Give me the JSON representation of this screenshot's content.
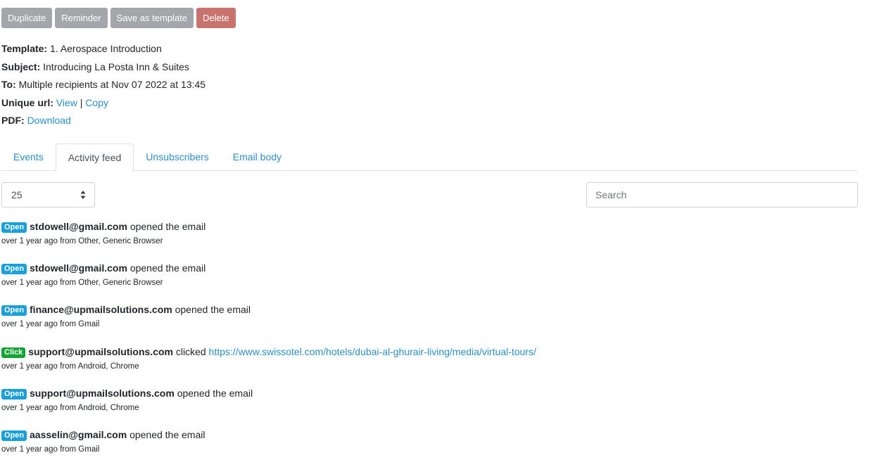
{
  "toolbar": {
    "duplicate_label": "Duplicate",
    "reminder_label": "Reminder",
    "save_template_label": "Save as template",
    "delete_label": "Delete"
  },
  "info": {
    "template_label": "Template:",
    "template_value": "1. Aerospace Introduction",
    "subject_label": "Subject:",
    "subject_value": "Introducing La Posta Inn & Suites",
    "to_label": "To:",
    "to_value": "Multiple recipients at Nov 07 2022 at 13:45",
    "url_label": "Unique url:",
    "url_view": "View",
    "url_sep": "|",
    "url_copy": "Copy",
    "pdf_label": "PDF:",
    "pdf_download": "Download"
  },
  "tabs": [
    {
      "label": "Events"
    },
    {
      "label": "Activity feed"
    },
    {
      "label": "Unsubscribers"
    },
    {
      "label": "Email body"
    }
  ],
  "controls": {
    "page_size": "25",
    "search_placeholder": "Search"
  },
  "feed": [
    {
      "badge": "Open",
      "email": "stdowell@gmail.com",
      "action": "opened the email",
      "link": "",
      "meta": "over 1 year ago from Other, Generic Browser"
    },
    {
      "badge": "Open",
      "email": "stdowell@gmail.com",
      "action": "opened the email",
      "link": "",
      "meta": "over 1 year ago from Other, Generic Browser"
    },
    {
      "badge": "Open",
      "email": "finance@upmailsolutions.com",
      "action": "opened the email",
      "link": "",
      "meta": "over 1 year ago from Gmail"
    },
    {
      "badge": "Click",
      "email": "support@upmailsolutions.com",
      "action": "clicked",
      "link": "https://www.swissotel.com/hotels/dubai-al-ghurair-living/media/virtual-tours/",
      "meta": "over 1 year ago from Android, Chrome"
    },
    {
      "badge": "Open",
      "email": "support@upmailsolutions.com",
      "action": "opened the email",
      "link": "",
      "meta": "over 1 year ago from Android, Chrome"
    },
    {
      "badge": "Open",
      "email": "aasselin@gmail.com",
      "action": "opened the email",
      "link": "",
      "meta": "over 1 year ago from Gmail"
    }
  ],
  "colors": {
    "link": "#2a8fc6",
    "open_badge": "#1a9fd8",
    "click_badge": "#12a336",
    "delete_button": "#c9736f",
    "grey_button": "#a3a6aa"
  }
}
